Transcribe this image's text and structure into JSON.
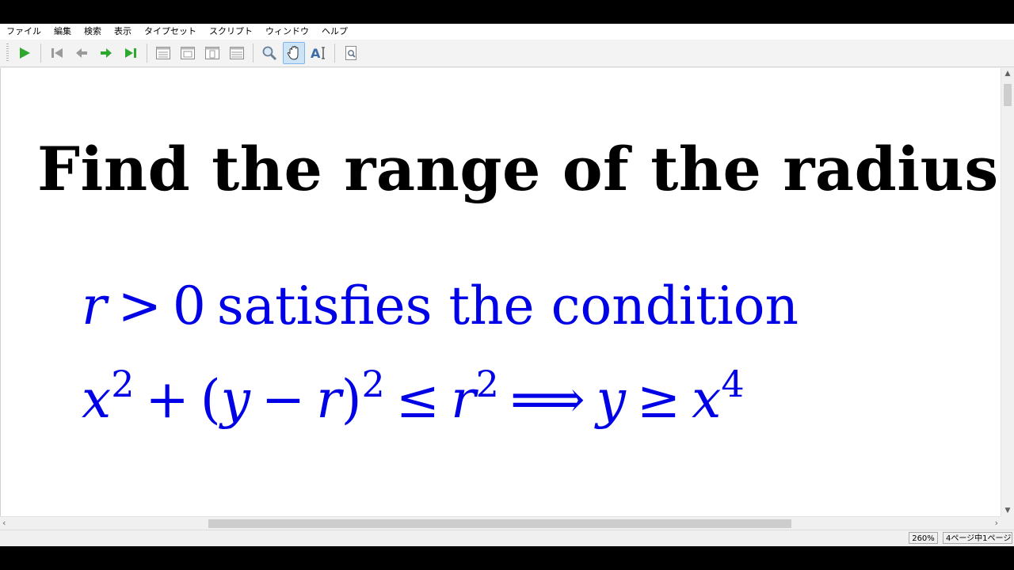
{
  "menu": [
    "ファイル",
    "編集",
    "検索",
    "表示",
    "タイプセット",
    "スクリプト",
    "ウィンドウ",
    "ヘルプ"
  ],
  "toolbar": {
    "buttons": [
      "typeset-play-icon",
      "first-page-icon",
      "previous-page-icon",
      "next-page-icon",
      "last-page-icon",
      "single-page-icon",
      "continuous-page-icon",
      "fit-page-icon",
      "fit-width-icon",
      "magnify-icon",
      "hand-tool-icon",
      "text-select-icon",
      "find-icon"
    ],
    "active_tool": "hand-tool-icon",
    "accent_green": "#2fa82f"
  },
  "document": {
    "title": "Find the range of the radius",
    "line1": {
      "var_r": "r",
      "gt": ">",
      "zero": "0",
      "text": "satisfies the condition"
    },
    "line2": {
      "x": "x",
      "exp_2a": "2",
      "plus": "+",
      "open_paren": "(",
      "y": "y",
      "minus": "−",
      "r": "r",
      "close_paren": ")",
      "exp_2b": "2",
      "leq": "≤",
      "r2": "r",
      "exp_2c": "2",
      "implies": "⟹",
      "y2": "y",
      "geq": "≥",
      "x2": "x",
      "exp_4": "4"
    },
    "title_color": "#000000",
    "math_color": "#0000e6"
  },
  "status": {
    "zoom": "260%",
    "page": "4ページ中1ページ"
  }
}
